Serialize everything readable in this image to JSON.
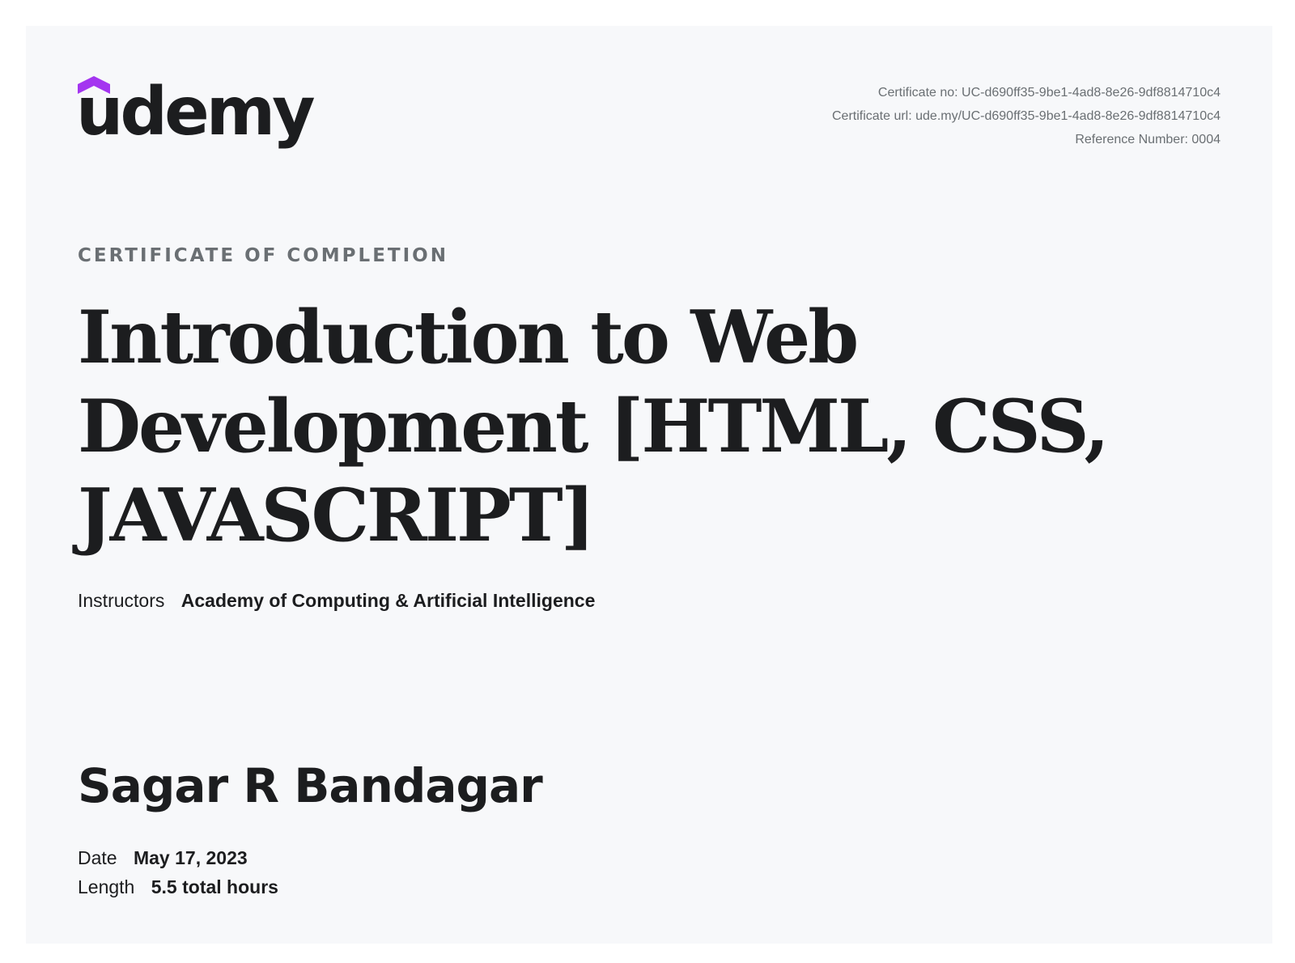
{
  "brand": {
    "name": "udemy",
    "accent_color": "#a435f0",
    "logo_icon": "udemy-cap-icon"
  },
  "certificate": {
    "number_line": "Certificate no: UC-d690ff35-9be1-4ad8-8e26-9df8814710c4",
    "url_line": "Certificate url: ude.my/UC-d690ff35-9be1-4ad8-8e26-9df8814710c4",
    "reference_line": "Reference Number: 0004",
    "eyebrow": "CERTIFICATE OF COMPLETION"
  },
  "course": {
    "title": "Introduction to Web Development [HTML, CSS, JAVASCRIPT]",
    "instructors_label": "Instructors",
    "instructors": "Academy of Computing & Artificial Intelligence"
  },
  "recipient": {
    "name": "Sagar R Bandagar"
  },
  "details": {
    "date_label": "Date",
    "date": "May 17, 2023",
    "length_label": "Length",
    "length": "5.5 total hours"
  }
}
